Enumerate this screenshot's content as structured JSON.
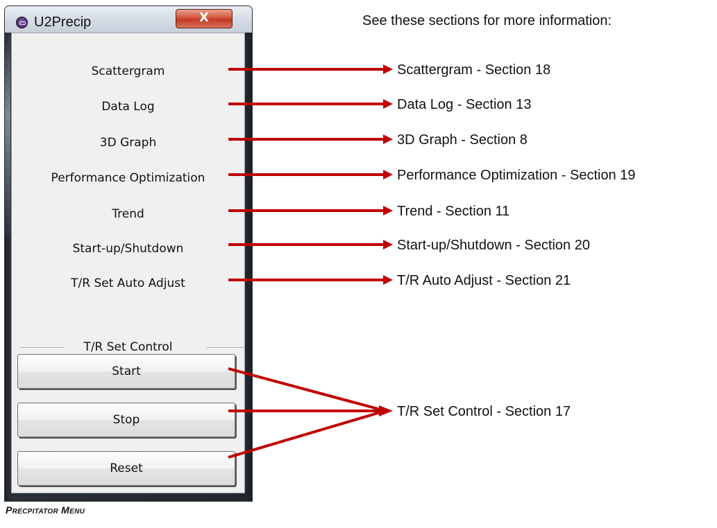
{
  "window": {
    "title": "U2Precip",
    "close_glyph": "X",
    "app_icon": "app-logo-icon"
  },
  "menu": {
    "items": [
      {
        "label": "Scattergram"
      },
      {
        "label": "Data Log"
      },
      {
        "label": "3D Graph"
      },
      {
        "label": "Performance Optimization"
      },
      {
        "label": "Trend"
      },
      {
        "label": "Start-up/Shutdown"
      },
      {
        "label": "T/R Set Auto Adjust"
      }
    ],
    "group_label": "T/R Set Control",
    "buttons": [
      {
        "label": "Start"
      },
      {
        "label": "Stop"
      },
      {
        "label": "Reset"
      }
    ]
  },
  "caption": "Precpitator Menu",
  "annotations": {
    "header": "See these sections for more information:",
    "refs": [
      {
        "label": "Scattergram - Section 18"
      },
      {
        "label": "Data Log - Section 13"
      },
      {
        "label": "3D Graph - Section 8"
      },
      {
        "label": "Performance Optimization - Section 19"
      },
      {
        "label": "Trend - Section 11"
      },
      {
        "label": "Start-up/Shutdown - Section 20"
      },
      {
        "label": "T/R Auto Adjust - Section 21"
      },
      {
        "label": "T/R Set Control - Section 17"
      }
    ],
    "arrow_color": "#c00000"
  }
}
